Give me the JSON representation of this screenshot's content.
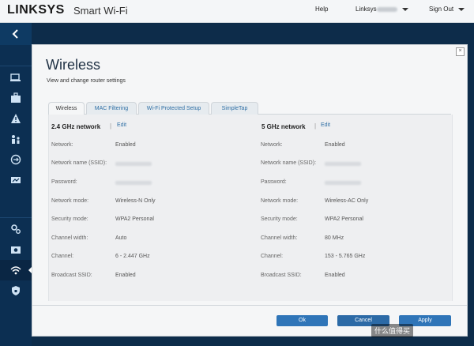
{
  "header": {
    "brand": "LINKSYS",
    "product": "Smart Wi-Fi",
    "help": "Help",
    "account": "Linksys",
    "sign_out": "Sign Out"
  },
  "dialog": {
    "title": "Wireless",
    "subtitle": "View and change router settings",
    "close": "×",
    "tabs": [
      {
        "label": "Wireless",
        "active": true
      },
      {
        "label": "MAC Filtering",
        "active": false
      },
      {
        "label": "Wi-Fi Protected Setup",
        "active": false
      },
      {
        "label": "SimpleTap",
        "active": false
      }
    ],
    "left": {
      "title": "2.4 GHz network",
      "sep": "|",
      "edit": "Edit",
      "labels": [
        "Network:",
        "Network name (SSID):",
        "Password:",
        "Network mode:",
        "Security mode:",
        "Channel width:",
        "Channel:",
        "Broadcast SSID:"
      ],
      "values": [
        "Enabled",
        "",
        "",
        "Wireless-N Only",
        "WPA2 Personal",
        "Auto",
        "6 - 2.447 GHz",
        "Enabled"
      ]
    },
    "right": {
      "title": "5 GHz network",
      "sep": "|",
      "edit": "Edit",
      "labels": [
        "Network:",
        "Network name (SSID):",
        "Password:",
        "Network mode:",
        "Security mode:",
        "Channel width:",
        "Channel:",
        "Broadcast SSID:"
      ],
      "values": [
        "Enabled",
        "",
        "",
        "Wireless-AC Only",
        "WPA2 Personal",
        "80 MHz",
        "153 - 5.765 GHz",
        "Enabled"
      ]
    },
    "buttons": {
      "ok": "Ok",
      "cancel": "Cancel",
      "apply": "Apply"
    }
  },
  "sidebar": {
    "icons": [
      "chevron-left-icon",
      "device-list-icon",
      "toolbox-icon",
      "warning-icon",
      "parental-controls-icon",
      "media-prioritization-icon",
      "speed-test-icon",
      "settings-gears-icon",
      "external-storage-icon",
      "wireless-icon",
      "security-shield-icon"
    ]
  },
  "watermark": "什么值得买",
  "colors": {
    "nav_bg": "#0c2f52",
    "accent": "#2f75b8",
    "link": "#2f6fa5"
  }
}
